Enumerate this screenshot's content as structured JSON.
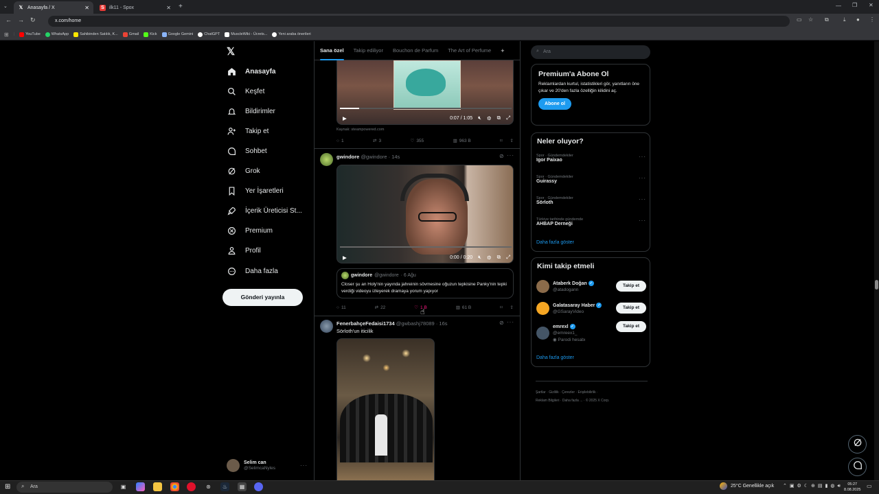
{
  "browser": {
    "tabs": [
      {
        "label": "Anasayfa / X",
        "icon": "x-icon"
      },
      {
        "label": "ilk11 - Spox",
        "icon": "spox-icon"
      }
    ],
    "address": "x.com/home",
    "bookmarks": [
      {
        "label": "YouTube",
        "color": "#ff0000"
      },
      {
        "label": "WhatsApp",
        "color": "#25d366"
      },
      {
        "label": "Sahibinden Satılık, K...",
        "color": "#ffe800"
      },
      {
        "label": "Gmail",
        "color": "#ea4335"
      },
      {
        "label": "Kick",
        "color": "#53fc18"
      },
      {
        "label": "Google Gemini",
        "color": "#8ab4f8"
      },
      {
        "label": "ChatGPT",
        "color": "#ffffff"
      },
      {
        "label": "MuscleWiki - Ücrets...",
        "color": "#ffffff"
      },
      {
        "label": "Yeni araba önerileri",
        "color": "#ffffff"
      }
    ]
  },
  "sidebar": {
    "items": [
      {
        "label": "Anasayfa",
        "icon": "home-icon"
      },
      {
        "label": "Keşfet",
        "icon": "search-icon"
      },
      {
        "label": "Bildirimler",
        "icon": "bell-icon"
      },
      {
        "label": "Takip et",
        "icon": "person-add-icon"
      },
      {
        "label": "Sohbet",
        "icon": "chat-icon"
      },
      {
        "label": "Grok",
        "icon": "grok-icon"
      },
      {
        "label": "Yer İşaretleri",
        "icon": "bookmark-icon"
      },
      {
        "label": "İçerik Üreticisi St...",
        "icon": "rocket-icon"
      },
      {
        "label": "Premium",
        "icon": "x-badge-icon"
      },
      {
        "label": "Profil",
        "icon": "person-icon"
      },
      {
        "label": "Daha fazla",
        "icon": "more-circle-icon"
      }
    ],
    "post_button": "Gönderi yayınla",
    "account": {
      "name": "Selim can",
      "handle": "@SelimcaNyles"
    }
  },
  "feed": {
    "tabs": [
      "Sana özel",
      "Takip ediliyor",
      "Bouchon de Parfum",
      "The Art of Perfume"
    ],
    "post1": {
      "video_time": "0:07 / 1:05",
      "source": "Kaynak: steampowered.com",
      "replies": "1",
      "reposts": "3",
      "likes": "355",
      "views": "963 B"
    },
    "post2": {
      "name": "gwindore",
      "handle": "@gwindore",
      "time": "· 14s",
      "video_time": "0:00 / 0:20",
      "quote_name": "gwindore",
      "quote_handle": "@gwindore",
      "quote_time": "· 6 Ağu",
      "quote_text": "Closer şu an Holy'nin yayında jahreinin sövmesine oğuzun tepkisine Panky'nin tepki verdiği videoyu izleyerek dramaya yorum yapıyor",
      "replies": "11",
      "reposts": "22",
      "likes": "1 B",
      "views": "61 B"
    },
    "post3": {
      "name": "FenerbahçeFedaisi1734",
      "handle": "@gwbashj78089",
      "time": "· 16s",
      "text": "Sörloth'un itici​lik"
    }
  },
  "right": {
    "search_placeholder": "Ara",
    "premium": {
      "title": "Premium'a Abone Ol",
      "desc": "Reklamlardan kurtul, istatistikleri gör, yanıtların öne çıkar ve 20'den fazla özelliğin kilidini aç.",
      "button": "Abone ol"
    },
    "trends_title": "Neler oluyor?",
    "trends": [
      {
        "meta": "Spor · Gündemdekiler",
        "name": "Igor Paixao"
      },
      {
        "meta": "Spor · Gündemdekiler",
        "name": "Guirassy"
      },
      {
        "meta": "Spor · Gündemdekiler",
        "name": "Sörloth"
      },
      {
        "meta": "Türkiye tarihinde gündemde",
        "name": "AHBAP Derneği"
      }
    ],
    "show_more": "Daha fazla göster",
    "who_title": "Kimi takip etmeli",
    "who": [
      {
        "name": "Ataberk Doğan",
        "handle": "@atadogann",
        "extra": "",
        "avatar_color": "#8b6b4a"
      },
      {
        "name": "Galatasaray Haber",
        "handle": "@GSarayVideo",
        "extra": "",
        "avatar_color": "#f5a623"
      },
      {
        "name": "emrexl",
        "handle": "@emreex1_",
        "extra": "Parodi hesabı",
        "avatar_color": "#445566"
      }
    ],
    "follow_label": "Takip et",
    "footer": [
      "Şartlar",
      "Gizlilik",
      "Çerezler",
      "Erişilebilirlik",
      "Reklam Bilgileri",
      "Daha fazla ...",
      "© 2025 X Corp."
    ]
  },
  "taskbar": {
    "search": "Ara",
    "weather": "25°C  Genellikle açık",
    "time": "05:27",
    "date": "8.08.2025"
  }
}
